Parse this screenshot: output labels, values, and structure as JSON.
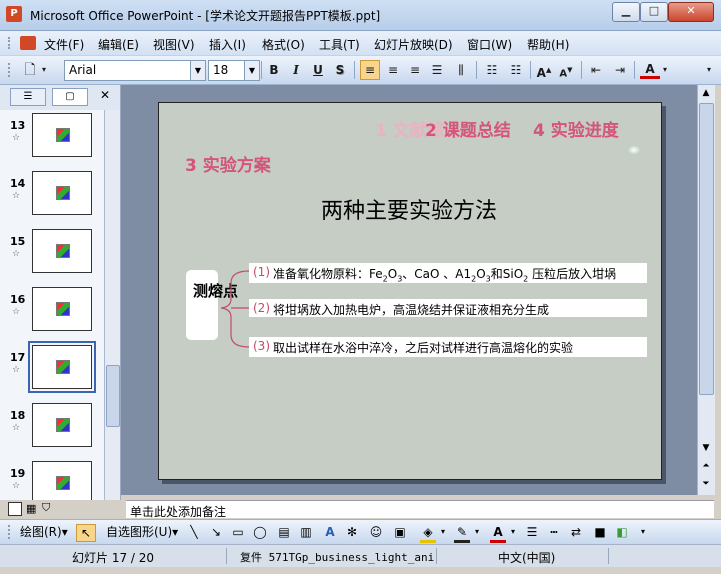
{
  "window": {
    "title": "Microsoft Office PowerPoint - [学术论文开题报告PPT模板.ppt]",
    "min_label": "▁",
    "max_label": "□",
    "close_label": "✕"
  },
  "menu": [
    "文件(F)",
    "编辑(E)",
    "视图(V)",
    "插入(I)",
    "格式(O)",
    "工具(T)",
    "幻灯片放映(D)",
    "窗口(W)",
    "帮助(H)"
  ],
  "toolbar": {
    "font_name": "Arial",
    "font_size": "18",
    "bold": "B",
    "italic": "I",
    "underline": "U",
    "shadow": "S",
    "font_color_label": "A"
  },
  "panel_tabs": {
    "outline": "☰",
    "slides": "▢",
    "close": "✕"
  },
  "slides": [
    {
      "num": "13",
      "star": "☆"
    },
    {
      "num": "14",
      "star": "☆"
    },
    {
      "num": "15",
      "star": "☆"
    },
    {
      "num": "16",
      "star": "☆"
    },
    {
      "num": "17",
      "star": "☆"
    },
    {
      "num": "18",
      "star": "☆"
    },
    {
      "num": "19",
      "star": "☆"
    }
  ],
  "slide": {
    "nav1": "1  文献综述",
    "nav2": "2  课题总结",
    "nav3": "4  实验进度",
    "nav4": "3  实验方案",
    "heading": "两种主要实验方法",
    "bracket_label": "测熔点",
    "items": [
      {
        "num": "(1)",
        "text_a": "准备氧化物原料：Fe",
        "text_b": "O",
        "text_c": "、CaO 、A1",
        "text_d": "O",
        "text_e": "和SiO",
        "text_f": " 压粒后放入坩埚",
        "sub1": "2",
        "sub2": "3",
        "sub3": "2",
        "sub4": "3",
        "sub5": "2"
      },
      {
        "num": "(2)",
        "text": "将坩埚放入加热电炉，高温烧结并保证液相充分生成"
      },
      {
        "num": "(3)",
        "text": "取出试样在水浴中淬冷，之后对试样进行高温熔化的实验"
      }
    ]
  },
  "notes_placeholder": "单击此处添加备注",
  "drawbar": {
    "draw": "绘图(R)▾",
    "autoshapes": "自选图形(U)▾"
  },
  "status": {
    "slide_pos": "幻灯片 17 / 20",
    "design": "复件 571TGp_business_light_ani",
    "lang": "中文(中国)"
  },
  "colors": {
    "accent_pink": "#d45579",
    "slide_bg": "#c5cdc5"
  }
}
